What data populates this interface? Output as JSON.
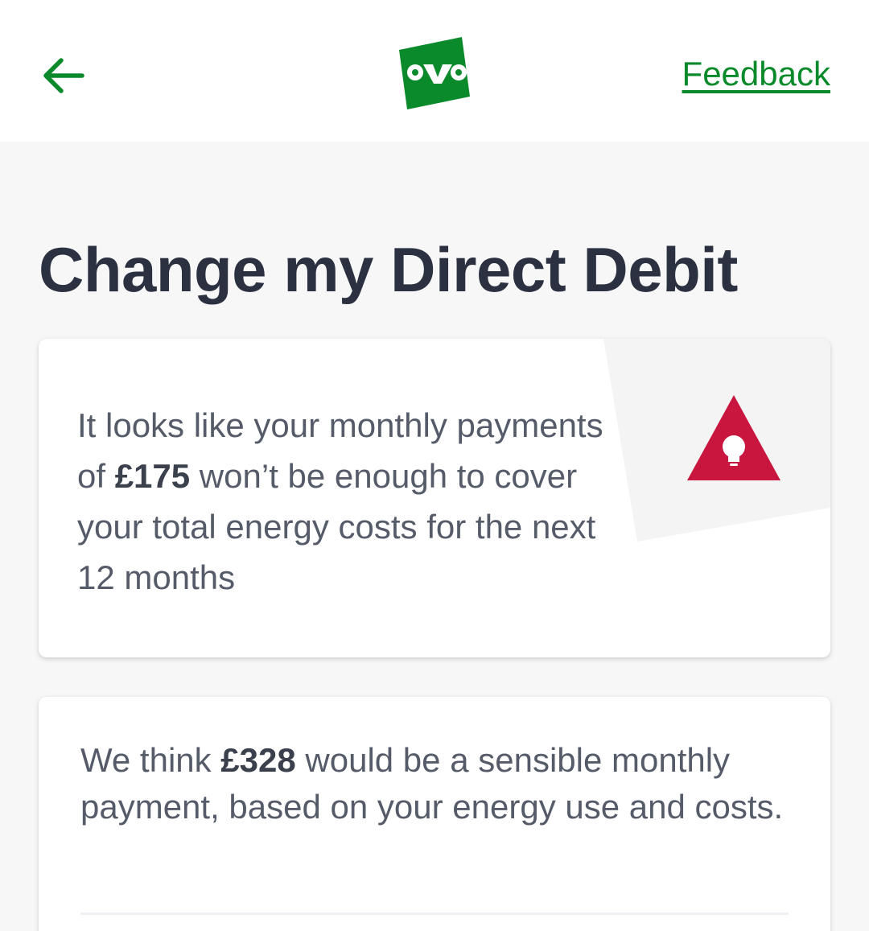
{
  "header": {
    "back_label": "Back",
    "logo_text": "ovo",
    "feedback_label": "Feedback"
  },
  "page": {
    "title": "Change my Direct Debit"
  },
  "warning_card": {
    "text_before": "It looks like your monthly payments of ",
    "amount": "£175",
    "text_after": " won’t be enough to cover your total energy costs for the next 12 months",
    "icon": "lightbulb-warning-icon"
  },
  "suggestion_card": {
    "text_before": "We think ",
    "amount": "£328",
    "text_after": " would be a sensible monthly payment, based on your energy use and costs."
  },
  "colors": {
    "brand_green": "#0a8a2b",
    "warning_red": "#c8163f",
    "title_text": "#2b3140",
    "body_text": "#555b68"
  }
}
